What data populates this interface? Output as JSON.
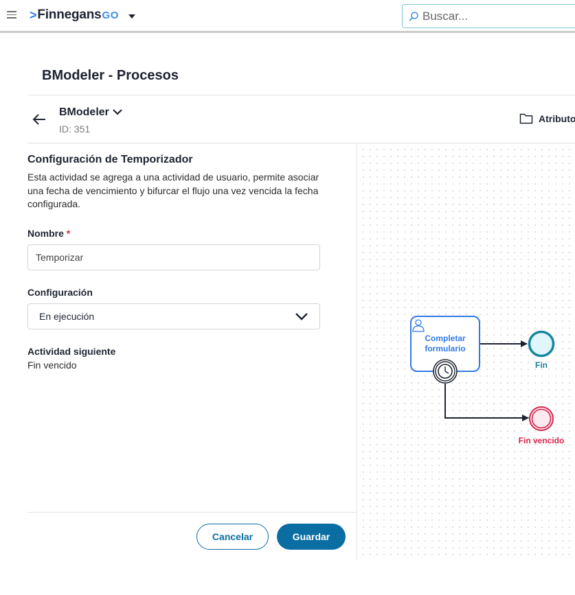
{
  "topbar": {
    "brand_name": "Finnegans",
    "brand_suffix": "GO",
    "brand_chevron": ">",
    "search_placeholder": "Buscar..."
  },
  "page": {
    "title": "BModeler - Procesos"
  },
  "model_header": {
    "name": "BModeler",
    "id_label": "ID: 351",
    "attributes_label": "Atributos"
  },
  "form": {
    "section_title": "Configuración de Temporizador",
    "section_description": "Esta actividad se agrega a una actividad de usuario, permite asociar una fecha de vencimiento y bifurcar el flujo una vez vencida la fecha configurada.",
    "name_label": "Nombre",
    "required_marker": "*",
    "name_value": "Temporizar",
    "config_label": "Configuración",
    "config_selected": "En ejecución",
    "next_activity_label": "Actividad siguiente",
    "next_activity_value": "Fin vencido"
  },
  "actions": {
    "cancel_label": "Cancelar",
    "save_label": "Guardar"
  },
  "diagram": {
    "task_label_line1": "Completar",
    "task_label_line2": "formulario",
    "end_event_label": "Fin",
    "expired_end_label": "Fin vencido",
    "colors": {
      "task_border": "#2f7ae5",
      "task_text": "#2f7ae5",
      "end_event": "#16869c",
      "expired_event": "#d3224c",
      "accent": "#0a6ea3"
    }
  },
  "icons": {
    "menu": "hamburger-icon",
    "search": "search-icon",
    "back": "arrow-left-icon",
    "folder": "folder-icon",
    "user": "user-icon",
    "timer": "clock-icon"
  }
}
